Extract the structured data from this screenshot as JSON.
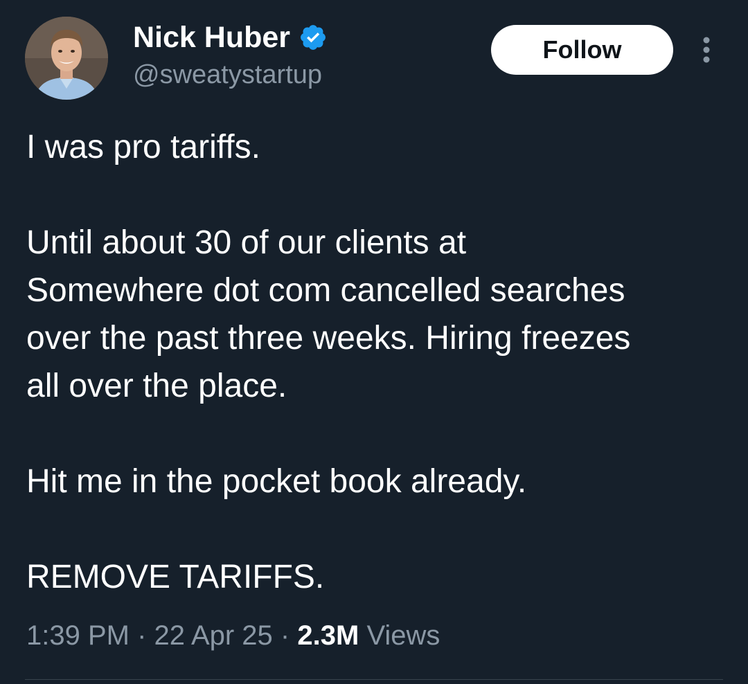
{
  "author": {
    "display_name": "Nick Huber",
    "handle": "@sweatystartup",
    "verified": true,
    "avatar_icon": "user-avatar-photo"
  },
  "actions": {
    "follow_label": "Follow",
    "more_icon": "vertical-ellipsis-icon"
  },
  "tweet": {
    "paragraphs": [
      "I was pro tariffs.",
      "Until about 30 of our clients at\nSomewhere dot com cancelled searches\nover the past three weeks. Hiring freezes\nall over the place.",
      "Hit me in the pocket book already.",
      "REMOVE TARIFFS."
    ]
  },
  "meta": {
    "time": "1:39 PM",
    "separator": "·",
    "date": "22 Apr 25",
    "views_count": "2.3M",
    "views_label": "Views"
  },
  "colors": {
    "background": "#16202b",
    "text": "#ffffff",
    "muted": "#8b98a5",
    "verified_blue": "#1d9bf0",
    "divider": "#38444d"
  }
}
